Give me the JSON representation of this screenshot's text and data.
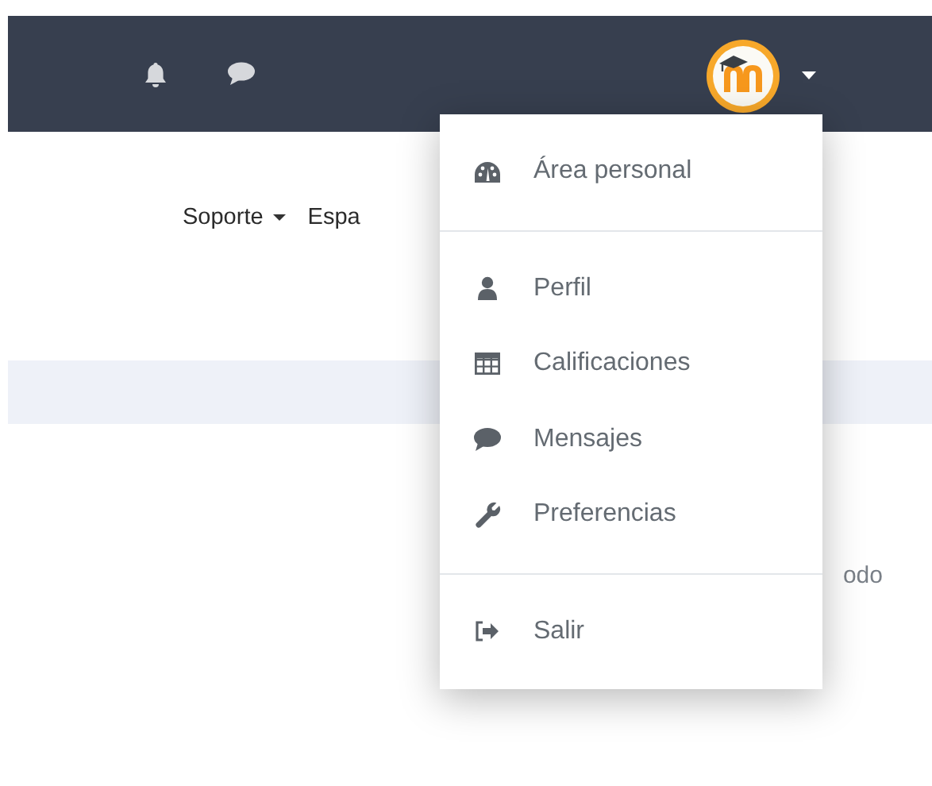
{
  "nav_links": [
    {
      "label": "Soporte",
      "has_caret": true
    },
    {
      "label": "Espa",
      "has_caret": false
    }
  ],
  "user_menu": {
    "expanded": true,
    "groups": [
      [
        {
          "kind": "dashboard",
          "label": "Área personal"
        }
      ],
      [
        {
          "kind": "user",
          "label": "Perfil"
        },
        {
          "kind": "grid",
          "label": "Calificaciones"
        },
        {
          "kind": "chat",
          "label": "Mensajes"
        },
        {
          "kind": "wrench",
          "label": "Preferencias"
        }
      ],
      [
        {
          "kind": "logout",
          "label": "Salir"
        }
      ]
    ]
  },
  "content_text": "odo"
}
